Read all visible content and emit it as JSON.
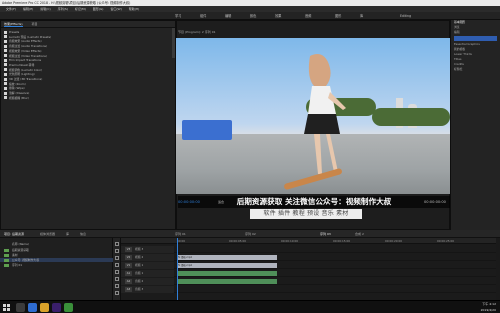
{
  "window": {
    "title": "Adobe Premiere Pro CC 2018 - H:\\视频剪辑\\项目\\后期资源获取 (公众号: 视频制作大叔)"
  },
  "menubar": {
    "items": [
      "文件(F)",
      "编辑(E)",
      "剪辑(C)",
      "序列(S)",
      "标记(M)",
      "图形(G)",
      "窗口(W)",
      "帮助(H)"
    ]
  },
  "workspaces": {
    "items": [
      "学习",
      "组件",
      "编辑",
      "颜色",
      "效果",
      "音频",
      "图形",
      "库",
      "Editing"
    ]
  },
  "left_panel": {
    "tabs": [
      "效果(Effects)",
      "项目"
    ],
    "tree": [
      "Presets",
      "Lumetri 预设 (Lumetri Presets)",
      "音频效果 (Audio Effects)",
      "音频过渡 (Audio Transitions)",
      "视频效果 (Video Effects)",
      "视频过渡 (Video Transitions)",
      "Film Impact Transitions",
      "Premiumbeat 转场",
      "视频调色 (Lumetri Color)",
      "光色照明 (Lighting)",
      "3D 过渡 (3D Transitions)",
      "缩放 (Zoom)",
      "擦除 (Wipe)",
      "溶解 (Dissolve)",
      "视频模糊 (Blur)"
    ]
  },
  "preview": {
    "header": "节目 (Program): 2 序列 01",
    "timecode_left": "00:00:00:00",
    "timecode_right": "00:00:00:00",
    "fit_label": "适合"
  },
  "overlay": {
    "main_text": "后期资源获取 关注微信公众号：视频制作大叔",
    "sub_text": "软件 插件 教程 预设 音乐 素材"
  },
  "bottom_tabs": {
    "items": [
      "项目: 后期资源",
      "媒体浏览器",
      "库",
      "信息",
      "序列 01",
      "序列 02",
      "序列 03",
      "合成 2"
    ]
  },
  "project_panel": {
    "rows": [
      "名称 (Name)",
      "后期资源获取",
      "素材",
      "公众号: 视频制作大叔",
      "序列 01"
    ],
    "selected_index": 3
  },
  "timeline": {
    "ruler_labels": [
      "00:00",
      "00:00:05:00",
      "00:00:10:00",
      "00:00:15:00",
      "00:00:20:00",
      "00:00:25:00"
    ],
    "tracks": [
      {
        "label": "V3",
        "name": "视频 3"
      },
      {
        "label": "V2",
        "name": "视频 2"
      },
      {
        "label": "V1",
        "name": "视频 1"
      },
      {
        "label": "A1",
        "name": "音频 1"
      },
      {
        "label": "A2",
        "name": "音频 2"
      },
      {
        "label": "A3",
        "name": "音频 3"
      }
    ],
    "clips": [
      {
        "track": 1,
        "label": "fx 滑板.mp4"
      },
      {
        "track": 2,
        "label": "fx 滑板.mp4"
      },
      {
        "track": 3,
        "label": ""
      },
      {
        "track": 4,
        "label": ""
      }
    ]
  },
  "right_panel": {
    "rows": [
      "基本图形",
      "浏览",
      "编辑",
      "Essential Graphics",
      "我的模板",
      "Lower Thirds",
      "Titles",
      "Credits",
      "标题栏"
    ]
  },
  "taskbar": {
    "time": "下午 4:12",
    "date": "2019/4/20"
  },
  "colors": {
    "accent": "#2f7fd9",
    "bg": "#1a1a1a",
    "panel": "#232323",
    "clip_video": "#b0b4be",
    "clip_audio": "#4f8f59"
  }
}
